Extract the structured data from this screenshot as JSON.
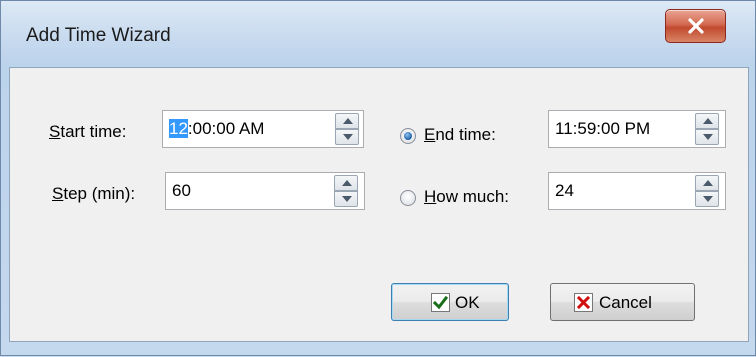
{
  "window": {
    "title": "Add Time Wizard",
    "close_glyph": "X"
  },
  "start_time": {
    "label": "Start time:",
    "value_highlight": "12",
    "value_rest": ":00:00 AM"
  },
  "step": {
    "label": "Step (min):",
    "value": "60"
  },
  "end_time": {
    "label": "End time:",
    "value": "11:59:00 PM",
    "selected": true
  },
  "how_much": {
    "label": "How much:",
    "value": "24",
    "selected": false
  },
  "buttons": {
    "ok": "OK",
    "cancel": "Cancel"
  },
  "colors": {
    "ok_check": "#1a6e1a",
    "cancel_x": "#d01010",
    "selection": "#3399ff",
    "close_button": "#c9553a"
  },
  "icons": [
    "close-icon",
    "check-icon",
    "cancel-x-icon",
    "spin-up-icon",
    "spin-down-icon"
  ]
}
